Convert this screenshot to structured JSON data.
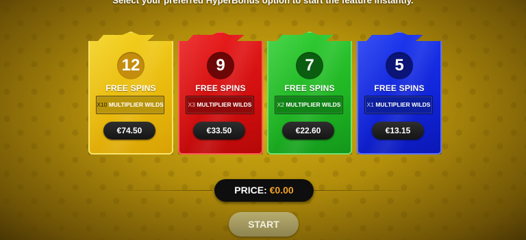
{
  "instruction": "Select your preferred HyperBonus option to start the feature instantly.",
  "options": [
    {
      "spins": "12",
      "free_label": "FREE SPINS",
      "multiplier_x": "X10",
      "multiplier_label": "MULTIPLIER WILDS",
      "price": "€74.50",
      "color": "#e8b80c"
    },
    {
      "spins": "9",
      "free_label": "FREE SPINS",
      "multiplier_x": "X3",
      "multiplier_label": "MULTIPLIER WILDS",
      "price": "€33.50",
      "color": "#d10e0e"
    },
    {
      "spins": "7",
      "free_label": "FREE SPINS",
      "multiplier_x": "X2",
      "multiplier_label": "MULTIPLIER WILDS",
      "price": "€22.60",
      "color": "#1fb423"
    },
    {
      "spins": "5",
      "free_label": "FREE SPINS",
      "multiplier_x": "X1",
      "multiplier_label": "MULTIPLIER WILDS",
      "price": "€13.15",
      "color": "#1124d8"
    }
  ],
  "price": {
    "label": "PRICE:",
    "value": "€0.00",
    "value_color": "#f3a32a"
  },
  "start_label": "START"
}
